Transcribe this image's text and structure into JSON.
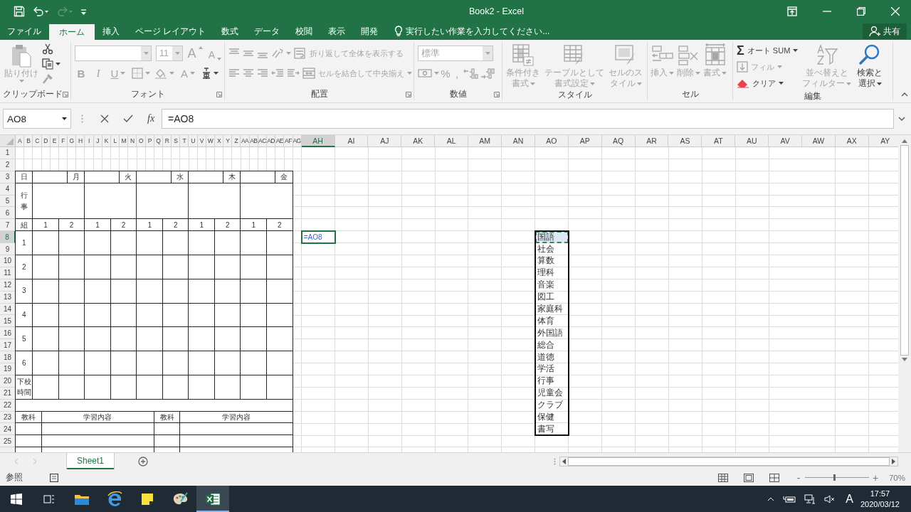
{
  "window": {
    "title": "Book2 - Excel"
  },
  "quick_access": [
    {
      "kind": "save",
      "disabled": false
    },
    {
      "kind": "undo",
      "disabled": false
    },
    {
      "kind": "redo",
      "disabled": true
    },
    {
      "kind": "customize",
      "disabled": false
    }
  ],
  "ribbon_tabs": [
    {
      "label": "ファイル",
      "selected": false
    },
    {
      "label": "ホーム",
      "selected": true
    },
    {
      "label": "挿入",
      "selected": false
    },
    {
      "label": "ページ レイアウト",
      "selected": false
    },
    {
      "label": "数式",
      "selected": false
    },
    {
      "label": "データ",
      "selected": false
    },
    {
      "label": "校閲",
      "selected": false
    },
    {
      "label": "表示",
      "selected": false
    },
    {
      "label": "開発",
      "selected": false
    }
  ],
  "tell_me": {
    "placeholder": "実行したい作業を入力してください..."
  },
  "share": {
    "label": "共有"
  },
  "ribbon_groups": [
    {
      "label": "クリップボード",
      "launcher": true,
      "commands": [
        {
          "kind": "paste",
          "label": "貼り付け",
          "disabled": true
        },
        {
          "kind": "cut",
          "disabled": false
        },
        {
          "kind": "copy",
          "disabled": false
        },
        {
          "kind": "format_painter",
          "disabled": true
        }
      ]
    },
    {
      "label": "フォント",
      "launcher": true,
      "commands": [
        {
          "kind": "font_name",
          "disabled": true
        },
        {
          "kind": "font_size",
          "value": "11",
          "disabled": true
        },
        {
          "kind": "grow",
          "glyph": "A",
          "disabled": true
        },
        {
          "kind": "shrink",
          "glyph": "A",
          "disabled": true
        },
        {
          "kind": "bold",
          "glyph": "B",
          "disabled": true
        },
        {
          "kind": "italic",
          "glyph": "I",
          "disabled": true
        },
        {
          "kind": "underline",
          "glyph": "U",
          "disabled": true
        },
        {
          "kind": "borders",
          "disabled": true
        },
        {
          "kind": "fill_color",
          "disabled": true
        },
        {
          "kind": "font_color",
          "glyph": "A",
          "disabled": true
        },
        {
          "kind": "phonetic",
          "disabled": false
        }
      ]
    },
    {
      "label": "配置",
      "launcher": true,
      "commands": [
        {
          "kind": "align_top",
          "disabled": true
        },
        {
          "kind": "align_middle",
          "disabled": true
        },
        {
          "kind": "align_bottom",
          "disabled": true
        },
        {
          "kind": "orientation",
          "disabled": true
        },
        {
          "kind": "wrap",
          "label": "折り返して全体を表示する",
          "disabled": true
        },
        {
          "kind": "align_left",
          "disabled": true
        },
        {
          "kind": "align_center",
          "disabled": true
        },
        {
          "kind": "align_right",
          "disabled": true
        },
        {
          "kind": "indent_dec",
          "disabled": true
        },
        {
          "kind": "indent_inc",
          "disabled": true
        },
        {
          "kind": "merge",
          "label": "セルを結合して中央揃え",
          "disabled": true
        }
      ]
    },
    {
      "label": "数値",
      "launcher": true,
      "commands": [
        {
          "kind": "number_format",
          "value": "標準",
          "disabled": true
        },
        {
          "kind": "currency",
          "disabled": true
        },
        {
          "kind": "percent",
          "glyph": "%",
          "disabled": true
        },
        {
          "kind": "comma",
          "glyph": ",",
          "disabled": true
        },
        {
          "kind": "inc_decimal",
          "disabled": true
        },
        {
          "kind": "dec_decimal",
          "disabled": true
        }
      ]
    },
    {
      "label": "スタイル",
      "launcher": false,
      "commands": [
        {
          "kind": "conditional",
          "label": "条件付き書式",
          "disabled": true
        },
        {
          "kind": "table_format",
          "label": "テーブルとして書式設定",
          "disabled": true
        },
        {
          "kind": "cell_style",
          "label": "セルのスタイル",
          "disabled": true
        }
      ]
    },
    {
      "label": "セル",
      "launcher": false,
      "commands": [
        {
          "kind": "insert",
          "label": "挿入",
          "disabled": true
        },
        {
          "kind": "delete",
          "label": "削除",
          "disabled": true
        },
        {
          "kind": "format",
          "label": "書式",
          "disabled": true
        }
      ]
    },
    {
      "label": "編集",
      "launcher": false,
      "commands": [
        {
          "kind": "autosum",
          "glyph": "Σ",
          "label": "オート SUM",
          "disabled": false
        },
        {
          "kind": "fill",
          "label": "フィル",
          "disabled": true
        },
        {
          "kind": "clear",
          "label": "クリア",
          "disabled": false
        },
        {
          "kind": "sort",
          "label": "並べ替えとフィルター",
          "disabled": true
        },
        {
          "kind": "find",
          "label": "検索と選択",
          "disabled": false
        }
      ]
    }
  ],
  "formula_bar": {
    "name_box": "AO8",
    "function_glyph": "fx",
    "formula": "=AO8"
  },
  "sheet": {
    "columns": [
      {
        "label": "A",
        "selected": false
      },
      {
        "label": "B",
        "selected": false
      },
      {
        "label": "C",
        "selected": false
      },
      {
        "label": "D",
        "selected": false
      },
      {
        "label": "E",
        "selected": false
      },
      {
        "label": "F",
        "selected": false
      },
      {
        "label": "G",
        "selected": false
      },
      {
        "label": "H",
        "selected": false
      },
      {
        "label": "I",
        "selected": false
      },
      {
        "label": "J",
        "selected": false
      },
      {
        "label": "K",
        "selected": false
      },
      {
        "label": "L",
        "selected": false
      },
      {
        "label": "M",
        "selected": false
      },
      {
        "label": "N",
        "selected": false
      },
      {
        "label": "O",
        "selected": false
      },
      {
        "label": "P",
        "selected": false
      },
      {
        "label": "Q",
        "selected": false
      },
      {
        "label": "R",
        "selected": false
      },
      {
        "label": "S",
        "selected": false
      },
      {
        "label": "T",
        "selected": false
      },
      {
        "label": "U",
        "selected": false
      },
      {
        "label": "V",
        "selected": false
      },
      {
        "label": "W",
        "selected": false
      },
      {
        "label": "X",
        "selected": false
      },
      {
        "label": "Y",
        "selected": false
      },
      {
        "label": "Z",
        "selected": false
      },
      {
        "label": "AA",
        "selected": false
      },
      {
        "label": "AB",
        "selected": false
      },
      {
        "label": "AC",
        "selected": false
      },
      {
        "label": "AD",
        "selected": false
      },
      {
        "label": "AE",
        "selected": false
      },
      {
        "label": "AF",
        "selected": false
      },
      {
        "label": "AG",
        "selected": false
      },
      {
        "label": "AH",
        "selected": true
      },
      {
        "label": "AI",
        "selected": false
      },
      {
        "label": "AJ",
        "selected": false
      },
      {
        "label": "AK",
        "selected": false
      },
      {
        "label": "AL",
        "selected": false
      },
      {
        "label": "AM",
        "selected": false
      },
      {
        "label": "AN",
        "selected": false
      },
      {
        "label": "AO",
        "selected": false
      },
      {
        "label": "AP",
        "selected": false
      },
      {
        "label": "AQ",
        "selected": false
      },
      {
        "label": "AR",
        "selected": false
      },
      {
        "label": "AS",
        "selected": false
      },
      {
        "label": "AT",
        "selected": false
      },
      {
        "label": "AU",
        "selected": false
      },
      {
        "label": "AV",
        "selected": false
      },
      {
        "label": "AW",
        "selected": false
      },
      {
        "label": "AX",
        "selected": false
      },
      {
        "label": "AY",
        "selected": false
      }
    ],
    "rows": [
      {
        "label": "1",
        "selected": false
      },
      {
        "label": "2",
        "selected": false
      },
      {
        "label": "3",
        "selected": false
      },
      {
        "label": "4",
        "selected": false
      },
      {
        "label": "5",
        "selected": false
      },
      {
        "label": "6",
        "selected": false
      },
      {
        "label": "7",
        "selected": false
      },
      {
        "label": "8",
        "selected": true
      },
      {
        "label": "9",
        "selected": false
      },
      {
        "label": "10",
        "selected": false
      },
      {
        "label": "11",
        "selected": false
      },
      {
        "label": "12",
        "selected": false
      },
      {
        "label": "13",
        "selected": false
      },
      {
        "label": "14",
        "selected": false
      },
      {
        "label": "15",
        "selected": false
      },
      {
        "label": "16",
        "selected": false
      },
      {
        "label": "17",
        "selected": false
      },
      {
        "label": "18",
        "selected": false
      },
      {
        "label": "19",
        "selected": false
      },
      {
        "label": "20",
        "selected": false
      },
      {
        "label": "21",
        "selected": false
      },
      {
        "label": "22",
        "selected": false
      },
      {
        "label": "23",
        "selected": false
      },
      {
        "label": "24",
        "selected": false
      },
      {
        "label": "25",
        "selected": false
      }
    ],
    "timetable": {
      "days": [
        "日",
        "月",
        "火",
        "水",
        "木",
        "金"
      ],
      "events_label": "行事",
      "class_label": "組",
      "classes": [
        "1",
        "2",
        "1",
        "2",
        "1",
        "2",
        "1",
        "2",
        "1",
        "2"
      ],
      "periods": [
        "1",
        "2",
        "3",
        "4",
        "5",
        "6"
      ],
      "dismissal_label": "下校時間",
      "study_headers": [
        "教科",
        "学習内容",
        "教科",
        "学習内容"
      ]
    },
    "active_cell": {
      "value": "=AO8"
    },
    "subjects": [
      "国語",
      "社会",
      "算数",
      "理科",
      "音楽",
      "図工",
      "家庭科",
      "体育",
      "外国語",
      "総合",
      "道徳",
      "学活",
      "行事",
      "児童会",
      "クラブ",
      "保健",
      "書写"
    ]
  },
  "sheet_tabs": [
    {
      "label": "Sheet1",
      "selected": true
    }
  ],
  "status_bar": {
    "mode": "参照",
    "zoom": {
      "minus": "-",
      "plus": "+",
      "level": 0.47,
      "reading": "70%"
    }
  },
  "taskbar": {
    "apps": [
      {
        "kind": "start",
        "selected": false
      },
      {
        "kind": "task_view",
        "selected": false
      },
      {
        "kind": "explorer",
        "selected": false
      },
      {
        "kind": "browser",
        "selected": false
      },
      {
        "kind": "sticky",
        "selected": false
      },
      {
        "kind": "paint",
        "selected": false
      },
      {
        "kind": "excel",
        "selected": true
      }
    ],
    "ime": "A",
    "time": "17:57",
    "date": "2020/03/12"
  }
}
